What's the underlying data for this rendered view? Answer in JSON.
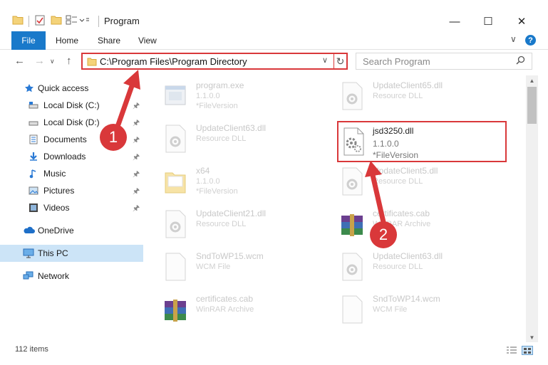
{
  "window": {
    "title": "Program",
    "minimize_glyph": "—",
    "maximize_glyph": "☐",
    "close_glyph": "✕"
  },
  "ribbon": {
    "tabs": [
      "File",
      "Home",
      "Share",
      "View"
    ],
    "help_glyph": "?"
  },
  "nav": {
    "address": "C:\\Program Files\\Program Directory",
    "search_placeholder": "Search Program"
  },
  "sidebar": {
    "items": [
      {
        "label": "Quick access",
        "icon": "star-icon"
      },
      {
        "label": "Local Disk (C:)",
        "icon": "drive-icon",
        "pinned": true
      },
      {
        "label": "Local Disk (D:)",
        "icon": "drive-icon",
        "pinned": true
      },
      {
        "label": "Documents",
        "icon": "documents-icon",
        "pinned": true
      },
      {
        "label": "Downloads",
        "icon": "downloads-icon",
        "pinned": true
      },
      {
        "label": "Music",
        "icon": "music-icon",
        "pinned": true
      },
      {
        "label": "Pictures",
        "icon": "pictures-icon",
        "pinned": true
      },
      {
        "label": "Videos",
        "icon": "videos-icon",
        "pinned": true
      },
      {
        "label": "OneDrive",
        "icon": "onedrive-icon"
      },
      {
        "label": "This PC",
        "icon": "this-pc-icon",
        "selected": true
      },
      {
        "label": "Network",
        "icon": "network-icon"
      }
    ]
  },
  "files": [
    {
      "name": "program.exe",
      "line2": "1.1.0.0",
      "line3": "*FileVersion",
      "icon": "exe-icon"
    },
    {
      "name": "UpdateClient65.dll",
      "line2": "Resource DLL",
      "line3": "",
      "icon": "dll-icon"
    },
    {
      "name": "UpdateClient63.dll",
      "line2": "Resource DLL",
      "line3": "",
      "icon": "dll-icon"
    },
    {
      "name": "jsd3250.dll",
      "line2": "1.1.0.0",
      "line3": "*FileVersion",
      "icon": "dll-icon",
      "highlighted": true
    },
    {
      "name": "x64",
      "line2": "1.1.0.0",
      "line3": "*FileVersion",
      "icon": "folder-icon"
    },
    {
      "name": "UpdateClient5.dll",
      "line2": "Resource DLL",
      "line3": "",
      "icon": "dll-icon"
    },
    {
      "name": "UpdateClient21.dll",
      "line2": "Resource DLL",
      "line3": "",
      "icon": "dll-icon"
    },
    {
      "name": "certificates.cab",
      "line2": "WinRAR Archive",
      "line3": "",
      "icon": "archive-icon"
    },
    {
      "name": "SndToWP15.wcm",
      "line2": "WCM File",
      "line3": "",
      "icon": "blank-file-icon"
    },
    {
      "name": "UpdateClient63.dll",
      "line2": "Resource DLL",
      "line3": "",
      "icon": "dll-icon"
    },
    {
      "name": "certificates.cab",
      "line2": "WinRAR Archive",
      "line3": "",
      "icon": "archive-icon"
    },
    {
      "name": "SndToWP14.wcm",
      "line2": "WCM File",
      "line3": "",
      "icon": "blank-file-icon"
    }
  ],
  "status": {
    "item_count": "112 items"
  },
  "annotations": {
    "badge_1": "1",
    "badge_2": "2"
  },
  "colors": {
    "accent": "#1979ca",
    "highlight_red": "#d9383a",
    "selected_bg": "#cce4f7"
  }
}
